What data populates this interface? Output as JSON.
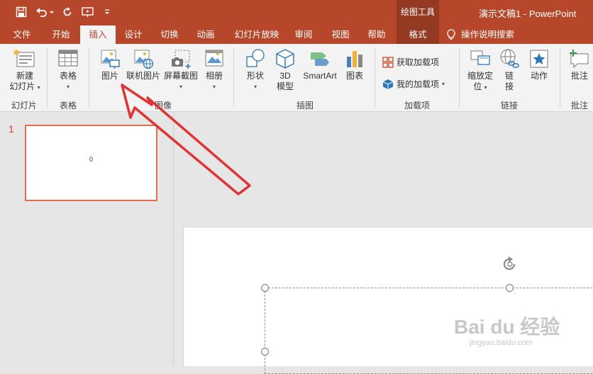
{
  "title": {
    "document": "演示文稿1",
    "separator": "-",
    "app": "PowerPoint"
  },
  "contextual": {
    "group_label": "绘图工具",
    "tab_label": "格式"
  },
  "tabs": [
    "文件",
    "开始",
    "插入",
    "设计",
    "切换",
    "动画",
    "幻灯片放映",
    "审阅",
    "视图",
    "帮助"
  ],
  "tell_me": "操作说明搜索",
  "ribbon": {
    "slides": {
      "new_slide_1": "新建",
      "new_slide_2": "幻灯片",
      "group": "幻灯片"
    },
    "tables": {
      "table": "表格",
      "group": "表格"
    },
    "images": {
      "picture": "图片",
      "online_picture": "联机图片",
      "screenshot": "屏幕截图",
      "album": "相册",
      "group": "图像"
    },
    "illustrations": {
      "shapes": "形状",
      "model_3d_1": "3D",
      "model_3d_2": "模型",
      "smartart": "SmartArt",
      "chart": "图表",
      "group": "插图"
    },
    "addins": {
      "get_addins": "获取加载项",
      "my_addins": "我的加载项",
      "group": "加载项"
    },
    "links": {
      "zoom_1": "缩放定",
      "zoom_2": "位",
      "link_1": "链",
      "link_2": "接",
      "action": "动作",
      "group": "链接"
    },
    "comments": {
      "comment": "批注",
      "group": "批注"
    }
  },
  "slides_panel": {
    "slide_number": "1",
    "thumb_text": "0"
  },
  "watermark": {
    "main": "Bai du 经验",
    "sub": "jingyan.baidu.com"
  },
  "colors": {
    "brand": "#b7472a",
    "context": "#953a22",
    "annotation_arrow": "#e03434"
  }
}
